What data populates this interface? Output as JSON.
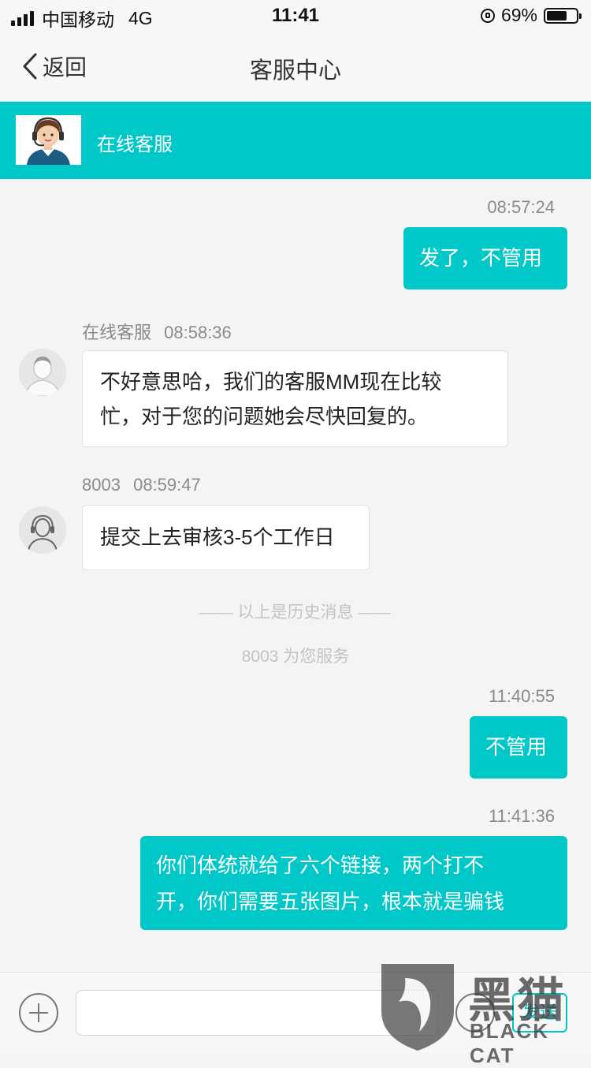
{
  "status_bar": {
    "carrier": "中国移动",
    "network": "4G",
    "time": "11:41",
    "battery_percent": "69%"
  },
  "nav": {
    "back_label": "返回",
    "title": "客服中心"
  },
  "banner": {
    "label": "在线客服",
    "color": "#00c7c8"
  },
  "messages": [
    {
      "time": "08:57:24",
      "text": "发了，不管用"
    },
    {
      "sender": "在线客服",
      "time": "08:58:36",
      "lines": [
        "不好意思哈，我们的客服MM现在比较",
        "忙，对于您的问题她会尽快回复的。"
      ]
    },
    {
      "sender": "8003",
      "time": "08:59:47",
      "text": "提交上去审核3-5个工作日"
    },
    {
      "time": "11:40:55",
      "text": "不管用"
    },
    {
      "time": "11:41:36",
      "lines": [
        "你们体统就给了六个链接，两个打不",
        "开，你们需要五张图片，根本就是骗钱"
      ]
    }
  ],
  "system_notes": {
    "history": "—— 以上是历史消息 ——",
    "service": "8003 为您服务"
  },
  "input_bar": {
    "plus_icon": "plus-icon",
    "emoji_icon": "emoji-icon",
    "send_label": "发送"
  },
  "watermark": {
    "cn": "黑猫",
    "en": "BLACK CAT"
  }
}
